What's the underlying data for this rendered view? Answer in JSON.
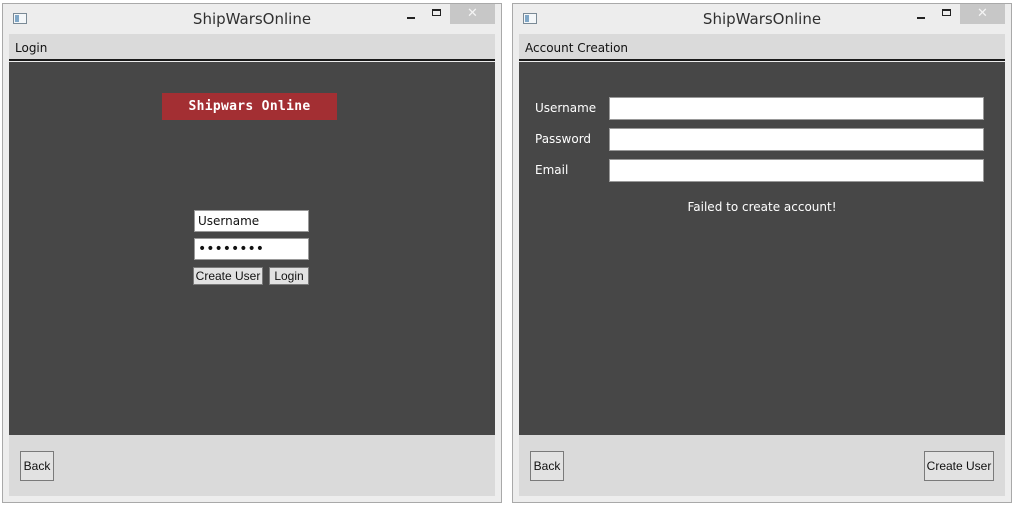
{
  "login_window": {
    "title": "ShipWarsOnline",
    "close_symbol": "✕",
    "menu_label": "Login",
    "banner": "Shipwars Online",
    "username_value": "Username",
    "password_value": "••••••••",
    "create_user_label": "Create User",
    "login_label": "Login",
    "back_label": "Back"
  },
  "create_window": {
    "title": "ShipWarsOnline",
    "close_symbol": "✕",
    "menu_label": "Account Creation",
    "username_label": "Username",
    "password_label": "Password",
    "email_label": "Email",
    "username_value": "",
    "password_value": "",
    "email_value": "",
    "status_message": "Failed to create account!",
    "back_label": "Back",
    "create_user_label": "Create User"
  },
  "colors": {
    "canvas": "#474747",
    "banner": "#a32f33",
    "chrome": "#dadada"
  },
  "icons": [
    "app-icon",
    "minimize-icon",
    "maximize-icon",
    "close-icon"
  ]
}
